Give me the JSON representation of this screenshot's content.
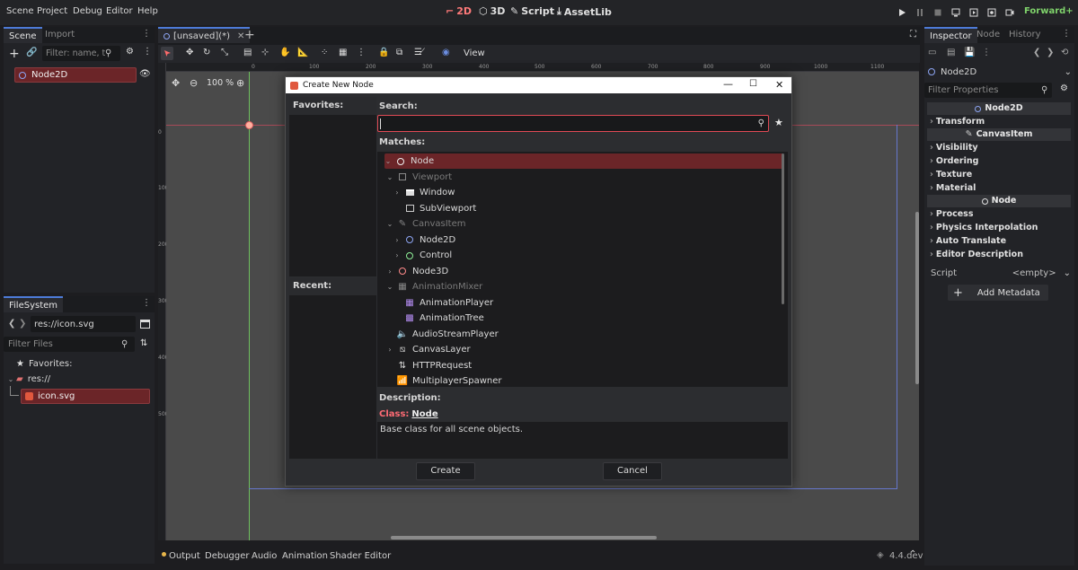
{
  "menu": [
    "Scene",
    "Project",
    "Debug",
    "Editor",
    "Help"
  ],
  "workspaces": [
    "2D",
    "3D",
    "Script",
    "AssetLib"
  ],
  "renderer": "Forward+",
  "scene_dock": {
    "tabs": [
      "Scene",
      "Import"
    ],
    "filter_placeholder": "Filter: name, t:t",
    "tree": [
      {
        "label": "Node2D"
      }
    ]
  },
  "filesystem": {
    "tab": "FileSystem",
    "path": "res://icon.svg",
    "filter_placeholder": "Filter Files",
    "items": [
      "Favorites:",
      "res://",
      "icon.svg"
    ]
  },
  "editor_tab": "[unsaved](*)",
  "toolbar": {
    "view_label": "View"
  },
  "zoom": "100 %",
  "ruler_ticks": [
    "0",
    "100",
    "200",
    "300",
    "400",
    "500",
    "600",
    "700",
    "800",
    "900",
    "1000",
    "1100"
  ],
  "vruler_ticks": [
    "0",
    "100",
    "200",
    "300",
    "400",
    "500"
  ],
  "dialog": {
    "title": "Create New Node",
    "favorites_label": "Favorites:",
    "recent_label": "Recent:",
    "search_label": "Search:",
    "search_value": "",
    "matches_label": "Matches:",
    "description_label": "Description:",
    "class_prefix": "Class:",
    "class_name": "Node",
    "description_text": "Base class for all scene objects.",
    "create_label": "Create",
    "cancel_label": "Cancel",
    "tree": [
      {
        "label": "Node",
        "indent": 0,
        "arrow": "v",
        "icon": "node",
        "selected": true
      },
      {
        "label": "Viewport",
        "indent": 1,
        "arrow": "v",
        "icon": "viewport",
        "dim": true
      },
      {
        "label": "Window",
        "indent": 2,
        "arrow": ">",
        "icon": "window"
      },
      {
        "label": "SubViewport",
        "indent": 2,
        "arrow": "",
        "icon": "subviewport"
      },
      {
        "label": "CanvasItem",
        "indent": 1,
        "arrow": "v",
        "icon": "canvasitem",
        "dim": true
      },
      {
        "label": "Node2D",
        "indent": 2,
        "arrow": ">",
        "icon": "node2d"
      },
      {
        "label": "Control",
        "indent": 2,
        "arrow": ">",
        "icon": "control"
      },
      {
        "label": "Node3D",
        "indent": 1,
        "arrow": ">",
        "icon": "node3d"
      },
      {
        "label": "AnimationMixer",
        "indent": 1,
        "arrow": "v",
        "icon": "animmixer",
        "dim": true
      },
      {
        "label": "AnimationPlayer",
        "indent": 2,
        "arrow": "",
        "icon": "animplayer"
      },
      {
        "label": "AnimationTree",
        "indent": 2,
        "arrow": "",
        "icon": "animtree"
      },
      {
        "label": "AudioStreamPlayer",
        "indent": 1,
        "arrow": "",
        "icon": "audio"
      },
      {
        "label": "CanvasLayer",
        "indent": 1,
        "arrow": ">",
        "icon": "canvaslayer"
      },
      {
        "label": "HTTPRequest",
        "indent": 1,
        "arrow": "",
        "icon": "http"
      },
      {
        "label": "MultiplayerSpawner",
        "indent": 1,
        "arrow": "",
        "icon": "mpspawner"
      }
    ]
  },
  "inspector": {
    "tabs": [
      "Inspector",
      "Node",
      "History"
    ],
    "object": "Node2D",
    "filter_placeholder": "Filter Properties",
    "sections": [
      {
        "type": "header",
        "label": "Node2D"
      },
      {
        "type": "group",
        "label": "Transform"
      },
      {
        "type": "header",
        "label": "CanvasItem"
      },
      {
        "type": "group",
        "label": "Visibility"
      },
      {
        "type": "group",
        "label": "Ordering"
      },
      {
        "type": "group",
        "label": "Texture"
      },
      {
        "type": "group",
        "label": "Material"
      },
      {
        "type": "header",
        "label": "Node"
      },
      {
        "type": "group",
        "label": "Process"
      },
      {
        "type": "group",
        "label": "Physics Interpolation"
      },
      {
        "type": "group",
        "label": "Auto Translate"
      },
      {
        "type": "group",
        "label": "Editor Description"
      }
    ],
    "script_label": "Script",
    "script_value": "<empty>",
    "add_metadata": "Add Metadata"
  },
  "bottom_tabs": [
    "Output",
    "Debugger",
    "Audio",
    "Animation",
    "Shader Editor"
  ],
  "version": "4.4.dev",
  "colors": {
    "accent": "#4d7bd8",
    "selection": "#6b2528",
    "node_red": "#ff8a8a",
    "node2d_blue": "#8da5f3",
    "control_green": "#8eef97"
  }
}
